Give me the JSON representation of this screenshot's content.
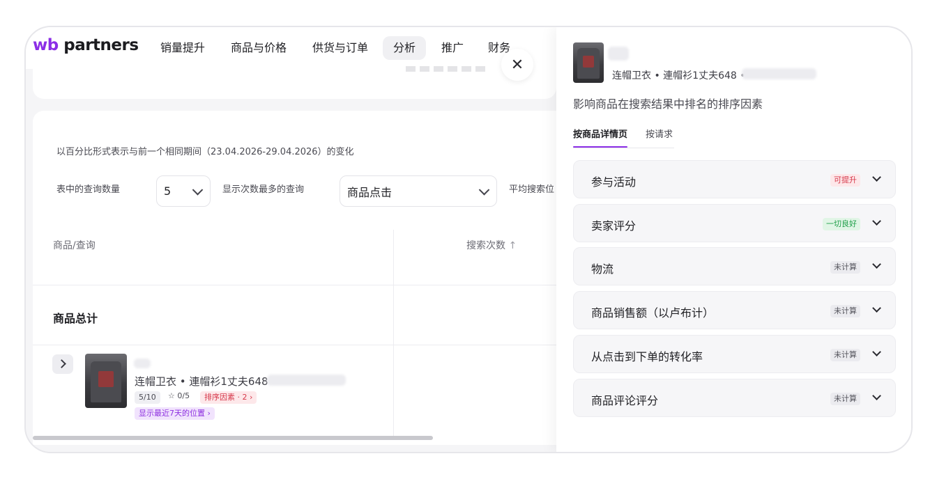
{
  "nav": {
    "logo_wb": "wb",
    "logo_partners": "partners",
    "items": [
      {
        "label": "销量提升"
      },
      {
        "label": "商品与价格"
      },
      {
        "label": "供货与订单"
      },
      {
        "label": "分析"
      },
      {
        "label": "推广"
      },
      {
        "label": "财务"
      }
    ],
    "active": "分析"
  },
  "filters": {
    "compare_note": "以百分比形式表示与前一个相同期间（23.04.2026-29.04.2026）的变化",
    "query_count_label": "表中的查询数量",
    "query_count_value": "5",
    "top_queries_label": "显示次数最多的查询",
    "top_queries_value": "商品点击",
    "avg_position_label": "平均搜索位"
  },
  "table": {
    "col_product": "商品/查询",
    "col_searches": "搜索次数",
    "sort_icon": "arrow-up-icon",
    "total_label": "商品总计",
    "row": {
      "product_name": "连帽卫衣 • 連帽衫1丈夫648 •",
      "rating_chip": "5/10",
      "stars_chip": "☆ 0/5",
      "ranking_factors_chip": "排序因素 · 2",
      "positions_chip": "显示最近7天的位置"
    }
  },
  "panel": {
    "product_name": "连帽卫衣 • 連帽衫1丈夫648 •",
    "title": "影响商品在搜索结果中排名的排序因素",
    "tabs": [
      {
        "label": "按商品详情页"
      },
      {
        "label": "按请求"
      }
    ],
    "active_tab": "按商品详情页",
    "factors": [
      {
        "label": "参与活动",
        "status": "可提升",
        "status_color": "#d6384a"
      },
      {
        "label": "卖家评分",
        "status": "一切良好",
        "status_color": "#1e9e48"
      },
      {
        "label": "物流",
        "status": "未计算",
        "status_color": "#55555d"
      },
      {
        "label": "商品销售额（以卢布计）",
        "status": "未计算",
        "status_color": "#55555d"
      },
      {
        "label": "从点击到下单的转化率",
        "status": "未计算",
        "status_color": "#55555d"
      },
      {
        "label": "商品评论评分",
        "status": "未计算",
        "status_color": "#55555d"
      }
    ]
  },
  "colors": {
    "accent": "#8b2ee6",
    "page_bg": "#f5f5f7"
  }
}
